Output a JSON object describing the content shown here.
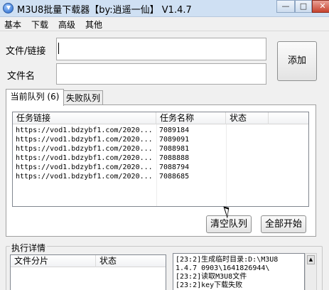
{
  "window": {
    "title": "M3U8批量下载器【by:逍遥一仙】 V1.4.7"
  },
  "menu": {
    "items": [
      "基本",
      "下载",
      "高级",
      "其他"
    ]
  },
  "form": {
    "file_label": "文件/链接",
    "file_value": "",
    "name_label": "文件名",
    "name_value": "",
    "add_button": "添加"
  },
  "tabs": {
    "current": "当前队列 (6)",
    "failed": "失败队列"
  },
  "queue": {
    "columns": [
      "任务链接",
      "任务名称",
      "状态"
    ],
    "rows": [
      {
        "link": "https://vod1.bdzybf1.com/2020...",
        "name": "7089184",
        "status": ""
      },
      {
        "link": "https://vod1.bdzybf1.com/2020...",
        "name": "7089091",
        "status": ""
      },
      {
        "link": "https://vod1.bdzybf1.com/2020...",
        "name": "7088981",
        "status": ""
      },
      {
        "link": "https://vod1.bdzybf1.com/2020...",
        "name": "7088888",
        "status": ""
      },
      {
        "link": "https://vod1.bdzybf1.com/2020...",
        "name": "7088794",
        "status": ""
      },
      {
        "link": "https://vod1.bdzybf1.com/2020...",
        "name": "7088685",
        "status": ""
      }
    ],
    "clear_button": "清空队列",
    "start_all_button": "全部开始"
  },
  "details": {
    "title": "执行详情",
    "columns": [
      "文件分片",
      "状态"
    ],
    "log": [
      "[23:2]生成临时目录:D:\\M3U8",
      "1.4.7 0903\\1641826944\\",
      "[23:2]读取M3U8文件",
      "[23:2]key下载失败"
    ]
  }
}
